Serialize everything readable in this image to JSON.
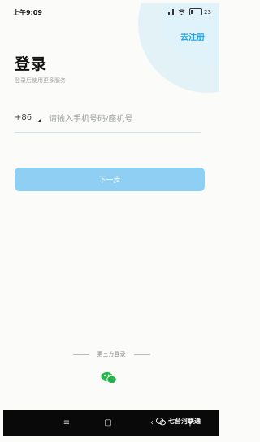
{
  "status_bar": {
    "time": "上午9:09",
    "battery": "23",
    "battery_level": 0.23
  },
  "header": {
    "register_link": "去注册",
    "title": "登录",
    "subtitle": "登录后使用更多服务"
  },
  "phone": {
    "country_code": "+86",
    "placeholder": "请输入手机号码/座机号",
    "value": ""
  },
  "next_button": "下一步",
  "third_party": {
    "label": "第三方登录",
    "wechat_icon": "wechat-icon"
  },
  "nav_bar": {
    "menu": "≡",
    "home": "▢",
    "back": "‹",
    "extra": "⚲"
  },
  "watermark": "七台河联通",
  "colors": {
    "accent": "#1aa3e8",
    "button": "#8ecff3",
    "wechat": "#24b24a"
  }
}
